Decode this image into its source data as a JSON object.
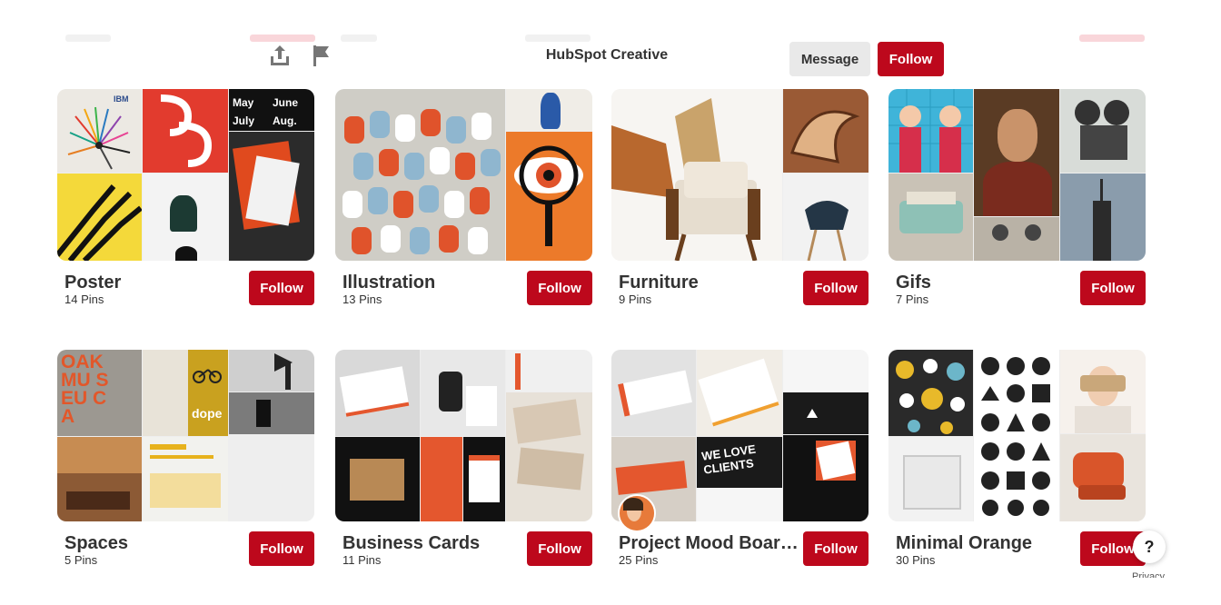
{
  "header": {
    "board_name": "HubSpot Creative",
    "message_label": "Message",
    "follow_label": "Follow"
  },
  "boards": [
    {
      "title": "Poster",
      "count": "14 Pins",
      "follow": "Follow"
    },
    {
      "title": "Illustration",
      "count": "13 Pins",
      "follow": "Follow"
    },
    {
      "title": "Furniture",
      "count": "9 Pins",
      "follow": "Follow"
    },
    {
      "title": "Gifs",
      "count": "7 Pins",
      "follow": "Follow"
    },
    {
      "title": "Spaces",
      "count": "5 Pins",
      "follow": "Follow"
    },
    {
      "title": "Business Cards",
      "count": "11 Pins",
      "follow": "Follow"
    },
    {
      "title": "Project Mood Boar…",
      "count": "25 Pins",
      "follow": "Follow"
    },
    {
      "title": "Minimal Orange",
      "count": "30 Pins",
      "follow": "Follow"
    }
  ],
  "poster_cover_text": {
    "brand": "IBM",
    "months": [
      "May",
      "June",
      "July",
      "Aug."
    ]
  },
  "spaces_cover_text": {
    "sign": "OAK MU SEU CA",
    "dope": "dope"
  },
  "mood_cover_text": {
    "we_love": "WE LOVE CLIENTS"
  },
  "help_label": "?",
  "privacy_label": "Privacy",
  "icons": [
    "share-icon",
    "flag-icon",
    "help-icon"
  ],
  "colors": {
    "accent": "#bd081c",
    "secondary_button": "#e9e9e9"
  }
}
